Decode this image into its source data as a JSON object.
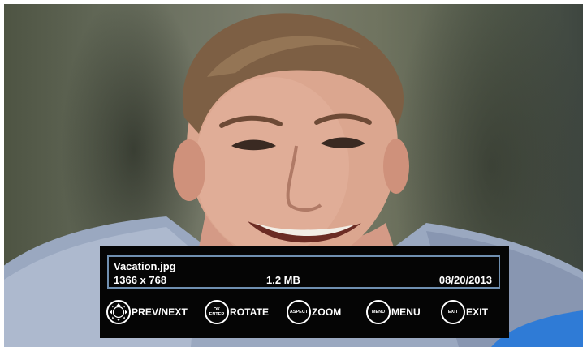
{
  "photo": {
    "subject": "smiling young man portrait"
  },
  "info": {
    "filename": "Vacation.jpg",
    "resolution": "1366 x 768",
    "filesize": "1.2 MB",
    "date": "08/20/2013"
  },
  "controls": [
    {
      "icon": "dpad-icon",
      "key": "",
      "label": "PREV/NEXT"
    },
    {
      "icon": "ok-enter-button-icon",
      "key_line1": "OK",
      "key_line2": "ENTER",
      "label": "ROTATE"
    },
    {
      "icon": "aspect-button-icon",
      "key": "ASPECT",
      "label": "ZOOM"
    },
    {
      "icon": "menu-button-icon",
      "key": "MENU",
      "label": "MENU"
    },
    {
      "icon": "exit-button-icon",
      "key": "EXIT",
      "label": "EXIT"
    }
  ],
  "colors": {
    "osd_background": "#050505",
    "info_border": "#6f8fb0",
    "text": "#ffffff"
  }
}
